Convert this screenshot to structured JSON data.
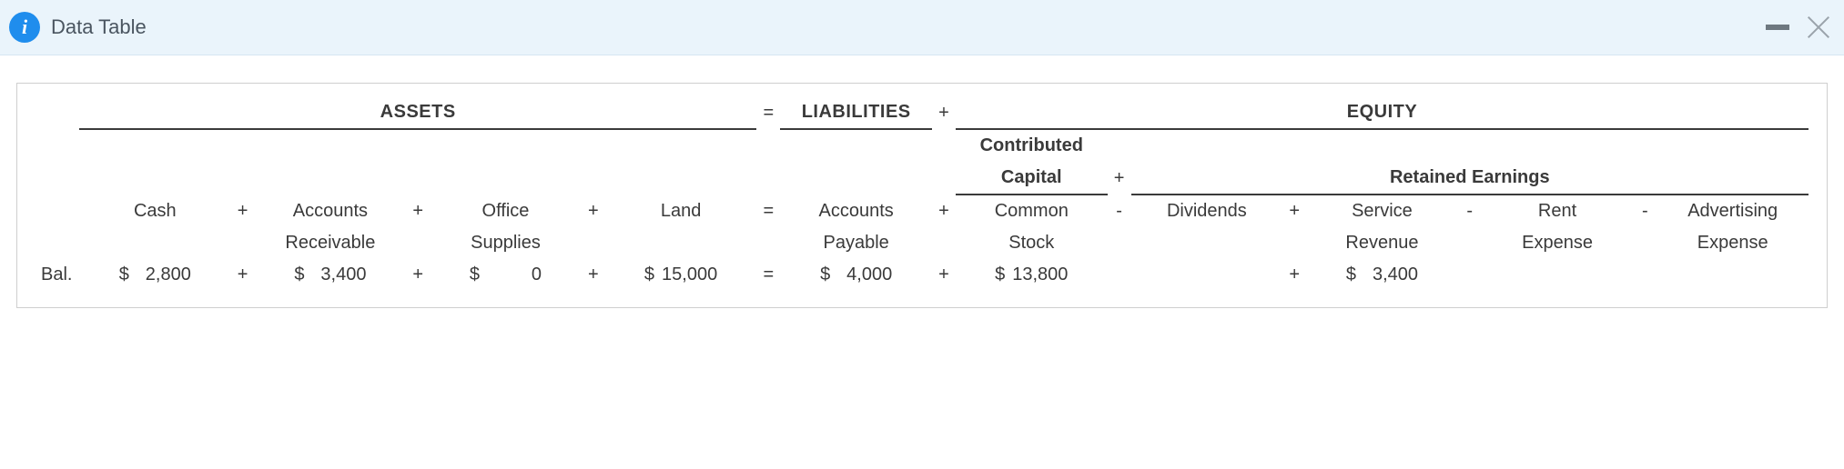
{
  "header": {
    "title": "Data Table"
  },
  "sections": {
    "assets": "ASSETS",
    "liabilities": "LIABILITIES",
    "equity": "EQUITY",
    "contributed": "Contributed",
    "capital": "Capital",
    "retained": "Retained Earnings"
  },
  "ops": {
    "eq": "=",
    "plus": "+",
    "minus": "-"
  },
  "cols": {
    "cash": "Cash",
    "ar1": "Accounts",
    "ar2": "Receivable",
    "os1": "Office",
    "os2": "Supplies",
    "land": "Land",
    "ap1": "Accounts",
    "ap2": "Payable",
    "cs1": "Common",
    "cs2": "Stock",
    "div": "Dividends",
    "sr1": "Service",
    "sr2": "Revenue",
    "re1": "Rent",
    "re2": "Expense",
    "ae1": "Advertising",
    "ae2": "Expense"
  },
  "row_label": "Bal.",
  "currency": "$",
  "values": {
    "cash": "2,800",
    "ar": "3,400",
    "os": "0",
    "land": "15,000",
    "ap": "4,000",
    "cs": "13,800",
    "sr": "3,400"
  },
  "chart_data": {
    "type": "table",
    "title": "Accounting Equation Balance",
    "columns": [
      "Cash",
      "Accounts Receivable",
      "Office Supplies",
      "Land",
      "Accounts Payable",
      "Common Stock",
      "Dividends",
      "Service Revenue",
      "Rent Expense",
      "Advertising Expense"
    ],
    "rows": [
      {
        "label": "Bal.",
        "values": [
          2800,
          3400,
          0,
          15000,
          4000,
          13800,
          null,
          3400,
          null,
          null
        ]
      }
    ],
    "equation": "ASSETS = LIABILITIES + EQUITY",
    "equity_breakdown": "Contributed Capital + Retained Earnings"
  }
}
